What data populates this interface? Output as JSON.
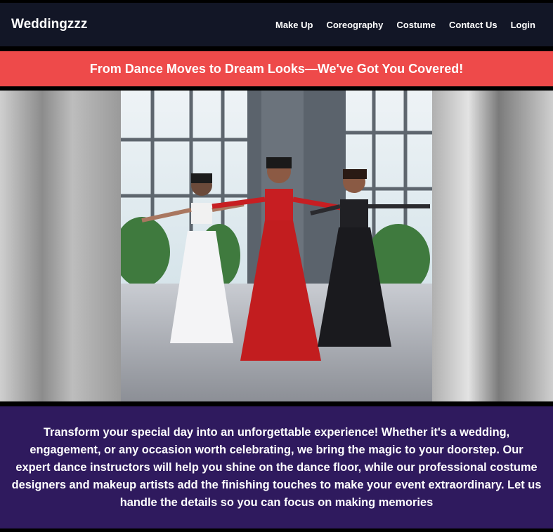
{
  "navbar": {
    "brand": "Weddingzzz",
    "links": [
      "Make Up",
      "Coreography",
      "Costume",
      "Contact Us",
      "Login"
    ]
  },
  "banner": {
    "text": "From Dance Moves to Dream Looks—We've Got You Covered!"
  },
  "hero": {
    "image_alt": "dance-performers-photo"
  },
  "description": {
    "text": "Transform your special day into an unforgettable experience! Whether it's a wedding, engagement, or any occasion worth celebrating, we bring the magic to your doorstep. Our expert dance instructors will help you shine on the dance floor, while our professional costume designers and makeup artists add the finishing touches to make your event extraordinary. Let us handle the details so you can focus on making memories"
  },
  "colors": {
    "navbar_bg": "#121626",
    "banner_bg": "#ee4a4a",
    "description_bg": "#2f1a5e"
  }
}
